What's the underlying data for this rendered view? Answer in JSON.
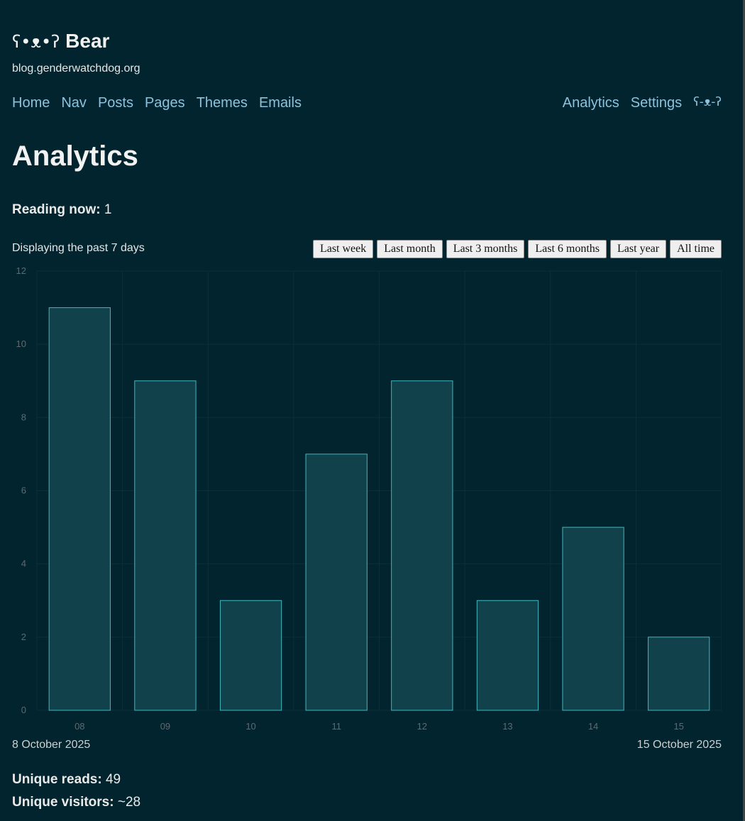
{
  "header": {
    "brand_glyph": "ʕ•ᴥ•ʔ",
    "brand_name": "Bear",
    "domain": "blog.genderwatchdog.org"
  },
  "nav": {
    "left": [
      "Home",
      "Nav",
      "Posts",
      "Pages",
      "Themes",
      "Emails"
    ],
    "right": [
      "Analytics",
      "Settings"
    ],
    "account_glyph": "ʕ-ᴥ-ʔ"
  },
  "page": {
    "title": "Analytics",
    "reading_now_label": "Reading now:",
    "reading_now_value": "1",
    "displaying_text": "Displaying the past 7 days"
  },
  "range_buttons": [
    "Last week",
    "Last month",
    "Last 3 months",
    "Last 6 months",
    "Last year",
    "All time"
  ],
  "chart_data": {
    "type": "bar",
    "categories": [
      "08",
      "09",
      "10",
      "11",
      "12",
      "13",
      "14",
      "15"
    ],
    "values": [
      11,
      9,
      3,
      7,
      9,
      3,
      5,
      2
    ],
    "ylim": [
      0,
      12
    ],
    "yticks": [
      0,
      2,
      4,
      6,
      8,
      10,
      12
    ],
    "grid": true,
    "bar_fill": "#11414b",
    "bar_stroke": "#3fb8c0",
    "grid_color": "#0b3038",
    "tick_color": "#5f6b6e"
  },
  "date_range": {
    "start": "8 October 2025",
    "end": "15 October 2025"
  },
  "stats": {
    "unique_reads_label": "Unique reads:",
    "unique_reads_value": "49",
    "unique_visitors_label": "Unique visitors:",
    "unique_visitors_value": "~28"
  },
  "colors": {
    "background": "#01242e",
    "link": "#8cc2dd",
    "text": "#eaeaea"
  }
}
